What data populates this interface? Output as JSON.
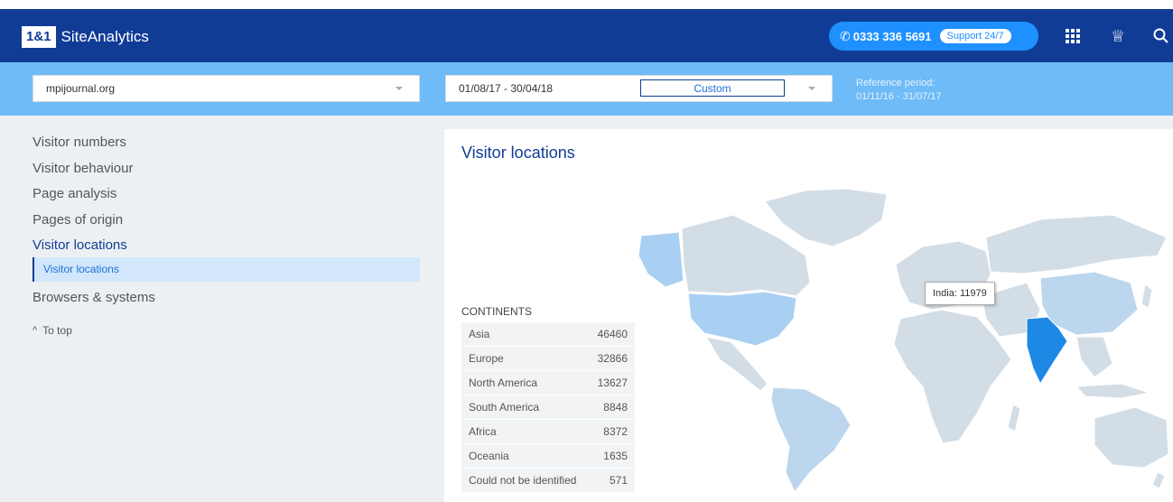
{
  "header": {
    "logo": "1&1",
    "app_name": "SiteAnalytics",
    "phone": "0333 336 5691",
    "support": "Support 24/7",
    "icons": [
      "grid-icon",
      "crown-icon",
      "search-icon"
    ]
  },
  "filters": {
    "site": "mpijournal.org",
    "date_range": "01/08/17 - 30/04/18",
    "custom_label": "Custom",
    "reference_label": "Reference period:",
    "reference_range": "01/11/16 - 31/07/17"
  },
  "sidebar": {
    "items": [
      {
        "label": "Visitor numbers"
      },
      {
        "label": "Visitor behaviour"
      },
      {
        "label": "Page analysis"
      },
      {
        "label": "Pages of origin"
      },
      {
        "label": "Visitor locations"
      }
    ],
    "sub_item": "Visitor locations",
    "after_item": "Browsers & systems",
    "to_top": "To top"
  },
  "panel": {
    "title": "Visitor locations",
    "table_title": "CONTINENTS",
    "rows": [
      {
        "name": "Asia",
        "value": "46460"
      },
      {
        "name": "Europe",
        "value": "32866"
      },
      {
        "name": "North America",
        "value": "13627"
      },
      {
        "name": "South America",
        "value": "8848"
      },
      {
        "name": "Africa",
        "value": "8372"
      },
      {
        "name": "Oceania",
        "value": "1635"
      },
      {
        "name": "Could not be identified",
        "value": "571"
      }
    ],
    "tooltip": "India: 11979"
  },
  "colors": {
    "header_bg": "#113c96",
    "filter_bg": "#6ebbf7",
    "accent": "#1e90ff",
    "map_base": "#d3dde6",
    "map_light": "#a9d0f2",
    "map_high": "#1e88e5"
  }
}
